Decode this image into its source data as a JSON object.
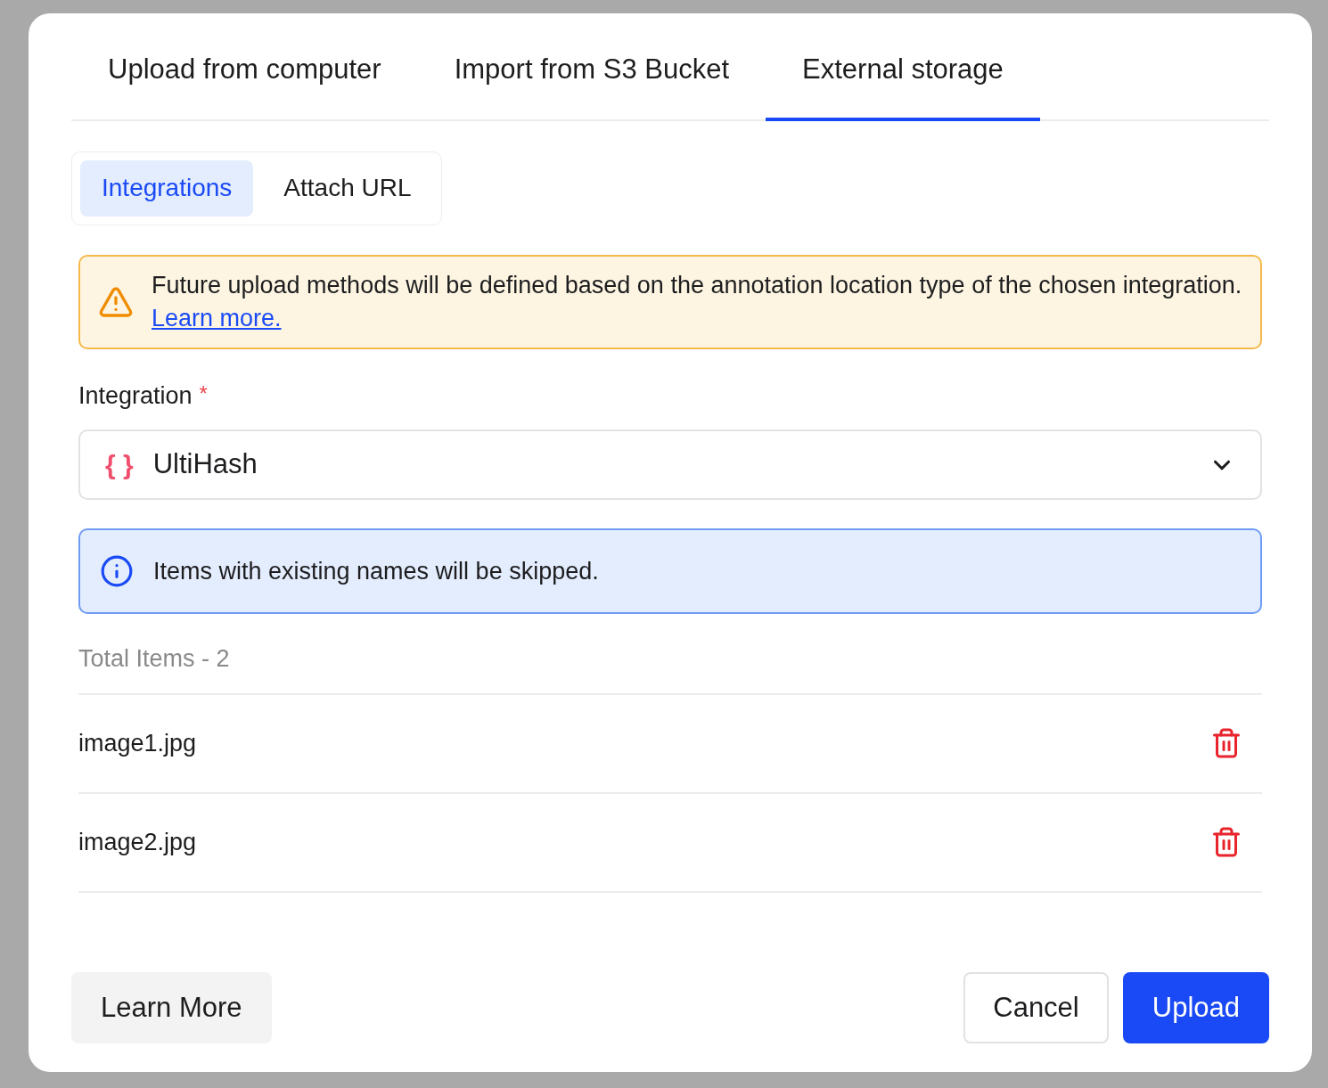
{
  "tabs": [
    {
      "label": "Upload from computer",
      "selected": false
    },
    {
      "label": "Import from S3 Bucket",
      "selected": false
    },
    {
      "label": "External storage",
      "selected": true
    }
  ],
  "subtabs": [
    {
      "label": "Integrations",
      "selected": true
    },
    {
      "label": "Attach URL",
      "selected": false
    }
  ],
  "warning": {
    "text": "Future upload methods will be defined based on the annotation location type of the chosen integration.",
    "link": "Learn more."
  },
  "integration_field": {
    "label": "Integration",
    "required_mark": "*",
    "icon_text": "{ }",
    "value": "UltiHash"
  },
  "info": {
    "text": "Items with existing names will be skipped."
  },
  "total": "Total Items - 2",
  "items": [
    {
      "name": "image1.jpg"
    },
    {
      "name": "image2.jpg"
    }
  ],
  "buttons": {
    "learn_more": "Learn More",
    "cancel": "Cancel",
    "upload": "Upload"
  }
}
